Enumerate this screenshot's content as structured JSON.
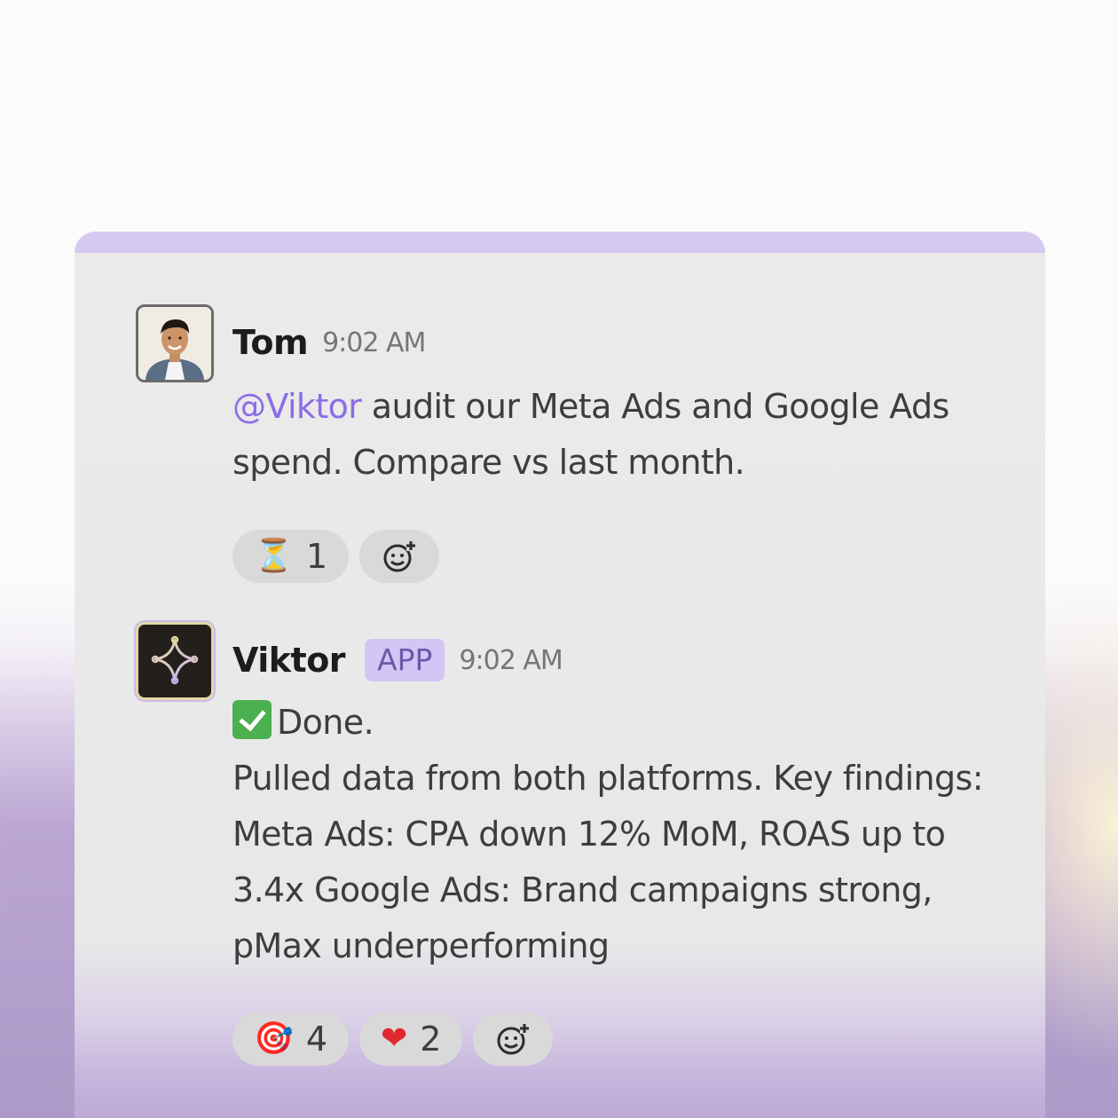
{
  "messages": [
    {
      "author": "Tom",
      "time": "9:02 AM",
      "mention": "@Viktor",
      "text": "audit our Meta Ads and Google Ads spend. Compare vs last month.",
      "reactions": [
        {
          "emoji": "⏳",
          "count": "1"
        }
      ]
    },
    {
      "author": "Viktor",
      "badge": "APP",
      "time": "9:02 AM",
      "status": "Done.",
      "text": "Pulled data from both platforms. Key findings: Meta Ads: CPA down 12% MoM, ROAS up to 3.4x Google Ads: Brand campaigns strong, pMax underperforming",
      "reactions": [
        {
          "emoji": "🎯",
          "count": "4"
        },
        {
          "emoji": "❤",
          "count": "2"
        }
      ]
    }
  ],
  "icons": {
    "add_reaction": "add-reaction-icon",
    "viktor_logo": "sparkle-outline-icon",
    "done": "check-mark-button-icon"
  },
  "colors": {
    "card_header": "#d5c8f1",
    "mention": "#8a6de6",
    "app_badge_bg": "#d3c5f5",
    "app_badge_text": "#6a5aa8"
  }
}
